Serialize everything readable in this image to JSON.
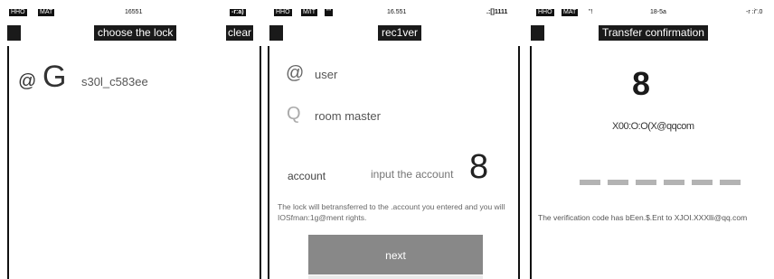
{
  "screen1": {
    "status": {
      "carrier": "HHO",
      "network": "MAT",
      "time": "16551",
      "battery": "-r:a)"
    },
    "title": "choose the lock",
    "clear_label": "clear",
    "lock": {
      "icon": "@",
      "badge": "G",
      "name": "s30l_c583ee"
    }
  },
  "screen2": {
    "status": {
      "carrier": "HHO",
      "network": "M/IT",
      "signal": "\"\"",
      "time": "16.551",
      "battery": ".:[]1111"
    },
    "title": "rec1ver",
    "options": [
      {
        "icon": "@",
        "label": "user"
      },
      {
        "icon": "Q",
        "label": "room master"
      }
    ],
    "account_label": "account",
    "account_placeholder": "input the account",
    "digit": "8",
    "note": "The lock will betransferred to the .account you entered and you will IOSfman:1g@ment rights.",
    "next_label": "next"
  },
  "screen3": {
    "status": {
      "carrier": "HHO",
      "network": "MAT",
      "signal": "\"!",
      "time": "18-5a",
      "battery": "-r :i\".0"
    },
    "title": "Transfer confirmation",
    "digit": "8",
    "email": "X00:O:O(X@qqcom",
    "code_cells": 6,
    "verify_text": "The verification code has bEen.$.Ent to XJOI.XXXlli@qq.com"
  }
}
